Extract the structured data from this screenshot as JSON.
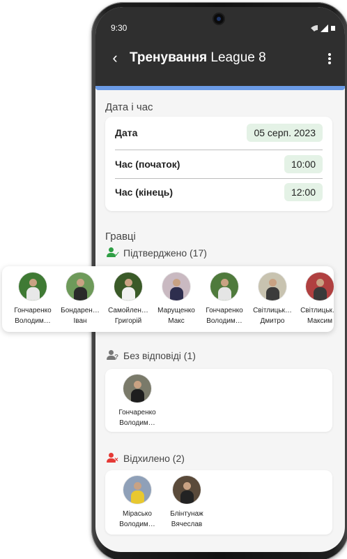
{
  "status_bar": {
    "time": "9:30"
  },
  "header": {
    "title_bold": "Тренування",
    "title_rest": "League 8"
  },
  "datetime": {
    "section_label": "Дата і час",
    "rows": [
      {
        "label": "Дата",
        "value": "05 серп. 2023"
      },
      {
        "label": "Час (початок)",
        "value": "10:00"
      },
      {
        "label": "Час (кінець)",
        "value": "12:00"
      }
    ]
  },
  "players": {
    "section_label": "Гравці",
    "confirmed": {
      "title": "Підтверджено (17)",
      "color": "#2e9e44",
      "people": [
        {
          "line1": "Гончаренко",
          "line2": "Володим…",
          "colors": [
            "#3f7a34",
            "#e8e8e8"
          ]
        },
        {
          "line1": "Бондарен…",
          "line2": "Іван",
          "colors": [
            "#6e9a5a",
            "#2a2a2a"
          ]
        },
        {
          "line1": "Самойлен…",
          "line2": "Григорій",
          "colors": [
            "#3a5a28",
            "#f1f1f1"
          ]
        },
        {
          "line1": "Марущенко",
          "line2": "Макс",
          "colors": [
            "#c9b9c1",
            "#2e2e4e"
          ]
        },
        {
          "line1": "Гончаренко",
          "line2": "Володим…",
          "colors": [
            "#4f7a3c",
            "#e5e5e5"
          ]
        },
        {
          "line1": "Світлицьк…",
          "line2": "Дмитро",
          "colors": [
            "#c8c3b0",
            "#3b3b3b"
          ]
        },
        {
          "line1": "Світлицьк…",
          "line2": "Максим",
          "colors": [
            "#b04040",
            "#3a3a3a"
          ]
        }
      ]
    },
    "no_reply": {
      "title": "Без відповіді (1)",
      "color": "#666666",
      "people": [
        {
          "line1": "Гончаренко",
          "line2": "Володим…",
          "colors": [
            "#7a7a6a",
            "#1e1e1e"
          ]
        }
      ]
    },
    "declined": {
      "title": "Відхилено (2)",
      "color": "#e53935",
      "people": [
        {
          "line1": "Мірасько",
          "line2": "Володим…",
          "colors": [
            "#8fa0b8",
            "#e8c830"
          ]
        },
        {
          "line1": "Блінтунаж",
          "line2": "Вячеслав",
          "colors": [
            "#5a4a3a",
            "#232323"
          ]
        }
      ]
    }
  }
}
